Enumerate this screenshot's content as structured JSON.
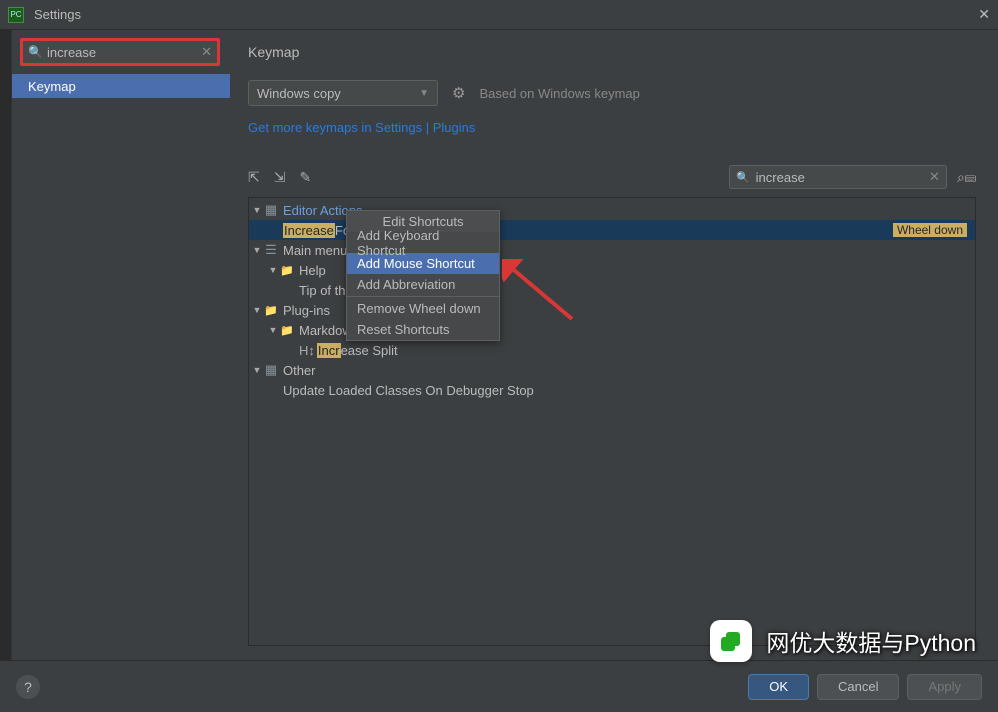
{
  "titlebar": {
    "app_label": "PC",
    "title": "Settings"
  },
  "sidebar": {
    "search_value": "increase",
    "nav": {
      "keymap": "Keymap"
    }
  },
  "main": {
    "title": "Keymap",
    "dropdown": "Windows copy",
    "based_on": "Based on Windows keymap",
    "link_prefix": "Get more keymaps in ",
    "link_settings": "Settings",
    "link_sep": " | ",
    "link_plugins": "Plugins",
    "search_value": "increase"
  },
  "tree": {
    "editor_actions": "Editor Actions",
    "increase_prefix": "Increase",
    "increase_suffix": " Font Size",
    "increase_shortcut": "Wheel down",
    "main_menu": "Main menu",
    "help": "Help",
    "tip": "Tip of the Day",
    "plugins": "Plug-ins",
    "markd": "Markdown",
    "incr_prefix": "Incr",
    "incr_suffix": "ease Split",
    "other": "Other",
    "update_loaded": "Update Loaded Classes On Debugger Stop"
  },
  "context_menu": {
    "header": "Edit Shortcuts",
    "add_keyboard": "Add Keyboard Shortcut",
    "add_mouse": "Add Mouse Shortcut",
    "add_abbrev": "Add Abbreviation",
    "remove": "Remove Wheel down",
    "reset": "Reset Shortcuts"
  },
  "footer": {
    "ok": "OK",
    "cancel": "Cancel",
    "apply": "Apply"
  },
  "watermark": "网优大数据与Python"
}
